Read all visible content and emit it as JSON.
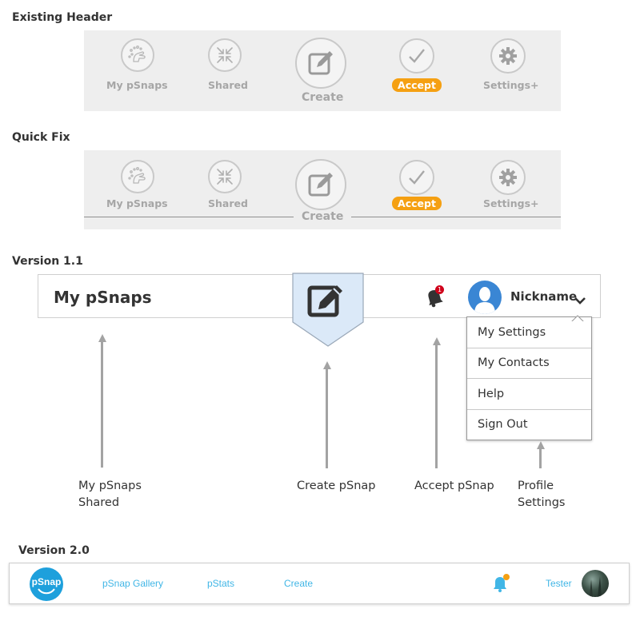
{
  "sections": {
    "existing": "Existing Header",
    "quick_fix": "Quick Fix",
    "v11": "Version 1.1",
    "v20": "Version 2.0"
  },
  "old_nav": {
    "my_psnaps": "My pSnaps",
    "shared": "Shared",
    "create": "Create",
    "accept": "Accept",
    "settings": "Settings+"
  },
  "v11": {
    "title": "My pSnaps",
    "notification_count": "1",
    "nickname": "Nickname",
    "menu": [
      "My Settings",
      "My Contacts",
      "Help",
      "Sign Out"
    ],
    "captions": {
      "mypsnaps_line1": "My pSnaps",
      "mypsnaps_line2": "Shared",
      "create": "Create pSnap",
      "accept": "Accept pSnap",
      "profile_line1": "Profile",
      "profile_line2": "Settings"
    }
  },
  "v20": {
    "logo": "pSnap",
    "nav": [
      "pSnap Gallery",
      "pStats",
      "Create"
    ],
    "user": "Tester"
  },
  "colors": {
    "accept_orange": "#f5a012",
    "create_blue": "#dbe9f8",
    "avatar_blue": "#3a86d4",
    "link_blue": "#41b6e6"
  }
}
